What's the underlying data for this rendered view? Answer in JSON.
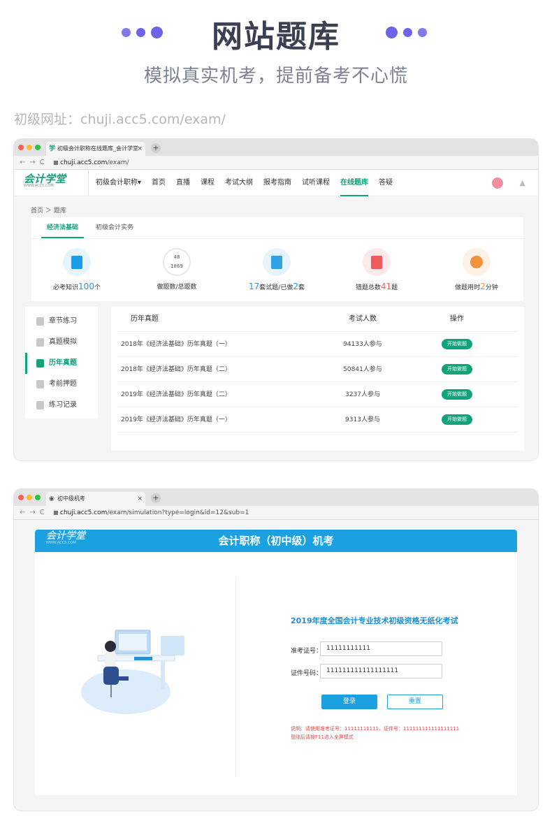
{
  "hero": {
    "title": "网站题库",
    "subtitle": "模拟真实机考，提前备考不心慌",
    "url_note": "初级网址：chuji.acc5.com/exam/"
  },
  "colors": {
    "brand_green": "#12a37d",
    "exam_blue": "#1ba1e2",
    "hero_dot": "#6b63e8",
    "alert_red": "#e54545"
  },
  "browser1": {
    "tab_title": "初级会计职称在线题库_会计学堂",
    "tab_close": "×",
    "newtab": "+",
    "url_host": "chuji.acc5.com",
    "url_path": "/exam/",
    "nav_buttons": "←→C"
  },
  "site": {
    "logo": "会计学堂",
    "logo_sub": "WWW.ACC5.COM",
    "nav": [
      "初级会计职称▾",
      "首页",
      "直播",
      "课程",
      "考试大纲",
      "报考指南",
      "试听课程",
      "在线题库",
      "答疑"
    ],
    "active_nav": "在线题库",
    "breadcrumb": "首页 ＞ 题库",
    "subtabs": [
      "经济法基础",
      "初级会计实务"
    ]
  },
  "stats": [
    {
      "icon": "document-icon",
      "color": "#1a9de6",
      "prefix": "必考知识",
      "num": "100",
      "suffix": "个"
    },
    {
      "icon": "progress-ring-icon",
      "color": "#1aa37f",
      "top": "48",
      "bottom": "1869",
      "label": "做题数/总题数"
    },
    {
      "icon": "exam-paper-icon",
      "color": "#2fa3e6",
      "num1": "17",
      "mid": "套试题/已做",
      "num2": "2",
      "suffix": "套"
    },
    {
      "icon": "error-list-icon",
      "color": "#ef5b5b",
      "prefix": "错题总数",
      "num": "41",
      "suffix": "题"
    },
    {
      "icon": "alarm-clock-icon",
      "color": "#f2923b",
      "prefix": "做题用时",
      "num": "2",
      "suffix": "分钟"
    }
  ],
  "sidebar": [
    "章节练习",
    "真题模拟",
    "历年真题",
    "考前押题",
    "练习记录"
  ],
  "sidebar_active": "历年真题",
  "table": {
    "headers": [
      "历年真题",
      "考试人数",
      "操作"
    ],
    "rows": [
      {
        "name": "2018年《经济法基础》历年真题（一）",
        "count": "94133人参与",
        "action": "开始做题"
      },
      {
        "name": "2018年《经济法基础》历年真题（二）",
        "count": "50841人参与",
        "action": "开始做题"
      },
      {
        "name": "2019年《经济法基础》历年真题（二）",
        "count": "3237人参与",
        "action": "开始做题"
      },
      {
        "name": "2019年《经济法基础》历年真题（一）",
        "count": "9313人参与",
        "action": "开始做题"
      }
    ]
  },
  "browser2": {
    "tab_title": "初中级机考",
    "tab_close": "×",
    "newtab": "+",
    "url_host": "chuji.acc5.com",
    "url_path": "/exam/simulation?type=login&id=12&sub=1",
    "nav_buttons": "←→C"
  },
  "exam": {
    "header": "会计职称（初中级）机考",
    "logo": "会计学堂",
    "logo_sub": "WWW.ACC5.COM",
    "title": "2019年度全国会计专业技术初级资格无纸化考试",
    "label_id": "准考证号：",
    "value_id": "11111111111",
    "label_cert": "证件号码：",
    "value_cert": "111111111111111111",
    "login": "登录",
    "reset": "重置",
    "note1": "说明：请使用准考证号：11111111111，证件号：111111111111111111",
    "note2": "登陆后请按F11进入全屏模式"
  }
}
